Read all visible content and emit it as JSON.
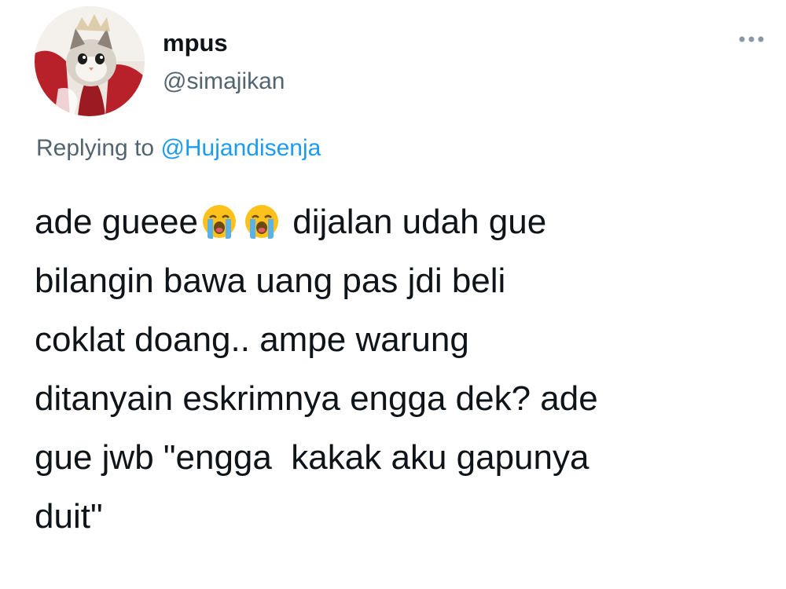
{
  "user": {
    "display_name": "mpus",
    "handle": "@simajikan",
    "avatar_icon": "cat-avatar"
  },
  "more_menu": {
    "icon": "more-horizontal-icon"
  },
  "reply_context": {
    "prefix": "Replying to ",
    "mention": "@Hujandisenja"
  },
  "tweet": {
    "lines": [
      {
        "before": "ade gueee",
        "emoji": "loudly-crying-face",
        "emoji_count": 2,
        "after": " dijalan udah gue"
      },
      {
        "text": "bilangin bawa uang pas jdi beli"
      },
      {
        "text": "coklat doang.. ampe warung"
      },
      {
        "text": "ditanyain eskrimnya engga dek? ade"
      },
      {
        "text": "gue jwb \"engga  kakak aku gapunya"
      },
      {
        "text": "duit\""
      }
    ]
  },
  "colors": {
    "text_primary": "#0f1419",
    "text_secondary": "#536471",
    "link": "#1d9bf0",
    "emoji_face": "#fcc21b",
    "emoji_tears": "#5bb1e8"
  }
}
